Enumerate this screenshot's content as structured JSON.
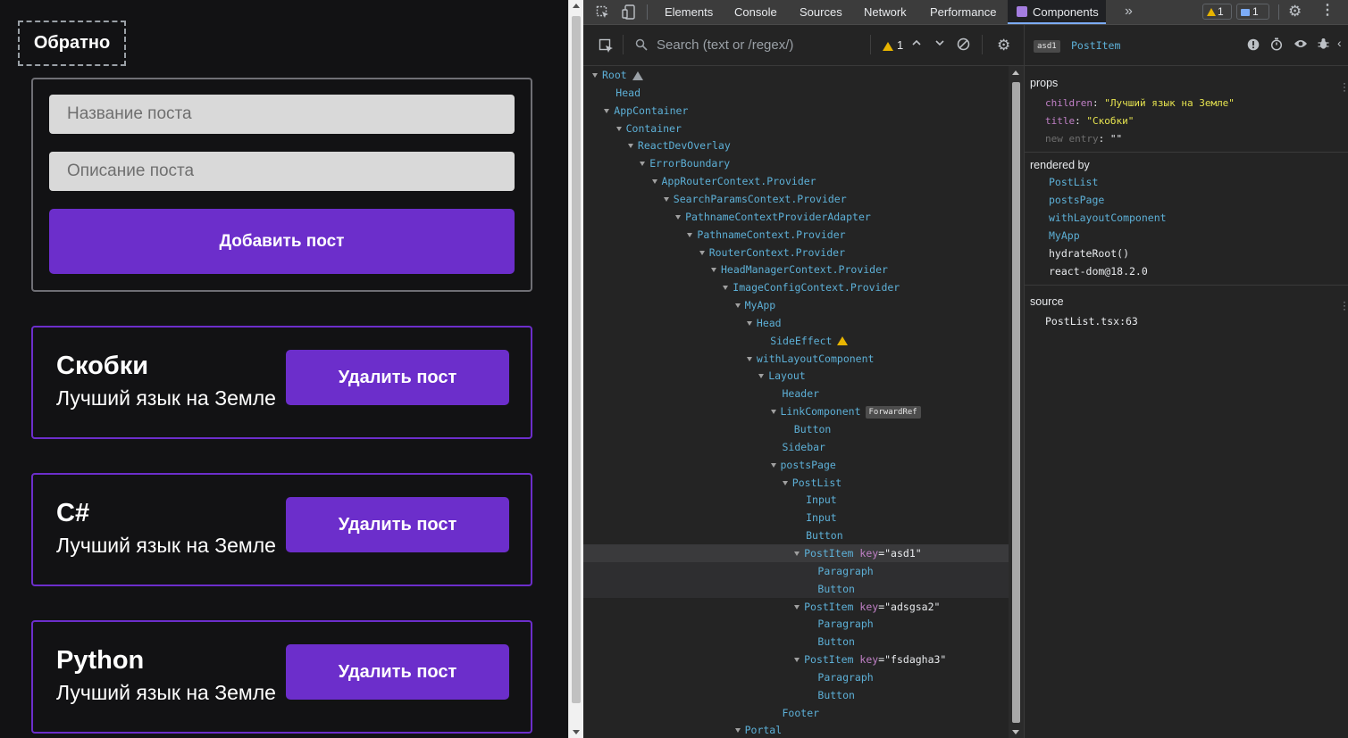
{
  "app": {
    "back_label": "Обратно",
    "title_placeholder": "Название поста",
    "description_placeholder": "Описание поста",
    "add_label": "Добавить пост",
    "delete_label": "Удалить пост",
    "posts": [
      {
        "title": "Скобки",
        "body": "Лучший язык на Земле"
      },
      {
        "title": "C#",
        "body": "Лучший язык на Земле"
      },
      {
        "title": "Python",
        "body": "Лучший язык на Земле"
      }
    ],
    "accent_color": "#6c2ecb"
  },
  "devtools": {
    "tabs": [
      "Elements",
      "Console",
      "Sources",
      "Network",
      "Performance",
      "Components"
    ],
    "active_tab": "Components",
    "warnings_count": "1",
    "messages_count": "1",
    "search_placeholder": "Search (text or /regex/)",
    "search_warning_count": "1",
    "tree": [
      {
        "name": "Root",
        "warn": "grey"
      },
      {
        "name": "Head"
      },
      {
        "name": "AppContainer"
      },
      {
        "name": "Container"
      },
      {
        "name": "ReactDevOverlay"
      },
      {
        "name": "ErrorBoundary"
      },
      {
        "name": "AppRouterContext.Provider"
      },
      {
        "name": "SearchParamsContext.Provider"
      },
      {
        "name": "PathnameContextProviderAdapter"
      },
      {
        "name": "PathnameContext.Provider"
      },
      {
        "name": "RouterContext.Provider"
      },
      {
        "name": "HeadManagerContext.Provider"
      },
      {
        "name": "ImageConfigContext.Provider"
      },
      {
        "name": "MyApp"
      },
      {
        "name": "Head"
      },
      {
        "name": "SideEffect",
        "warn": "yellow"
      },
      {
        "name": "withLayoutComponent"
      },
      {
        "name": "Layout"
      },
      {
        "name": "Header"
      },
      {
        "name": "LinkComponent",
        "badge": "ForwardRef"
      },
      {
        "name": "Button"
      },
      {
        "name": "Sidebar"
      },
      {
        "name": "postsPage"
      },
      {
        "name": "PostList"
      },
      {
        "name": "Input"
      },
      {
        "name": "Input"
      },
      {
        "name": "Button"
      },
      {
        "name": "PostItem",
        "key": "\"asd1\""
      },
      {
        "name": "Paragraph"
      },
      {
        "name": "Button"
      },
      {
        "name": "PostItem",
        "key": "\"adsgsa2\""
      },
      {
        "name": "Paragraph"
      },
      {
        "name": "Button"
      },
      {
        "name": "PostItem",
        "key": "\"fsdagha3\""
      },
      {
        "name": "Paragraph"
      },
      {
        "name": "Button"
      },
      {
        "name": "Footer"
      },
      {
        "name": "Portal"
      }
    ],
    "selected": {
      "key_chip": "asd1",
      "component": "PostItem",
      "props_title": "props",
      "props": [
        {
          "key": "children",
          "value": "\"Лучший язык на Земле\""
        },
        {
          "key": "title",
          "value": "\"Скобки\""
        },
        {
          "key": "new entry",
          "value": "\"\""
        }
      ],
      "rendered_by_title": "rendered by",
      "rendered_by": [
        "PostList",
        "postsPage",
        "withLayoutComponent",
        "MyApp",
        "hydrateRoot()",
        "react-dom@18.2.0"
      ],
      "source_title": "source",
      "source": "PostList.tsx:63"
    }
  }
}
